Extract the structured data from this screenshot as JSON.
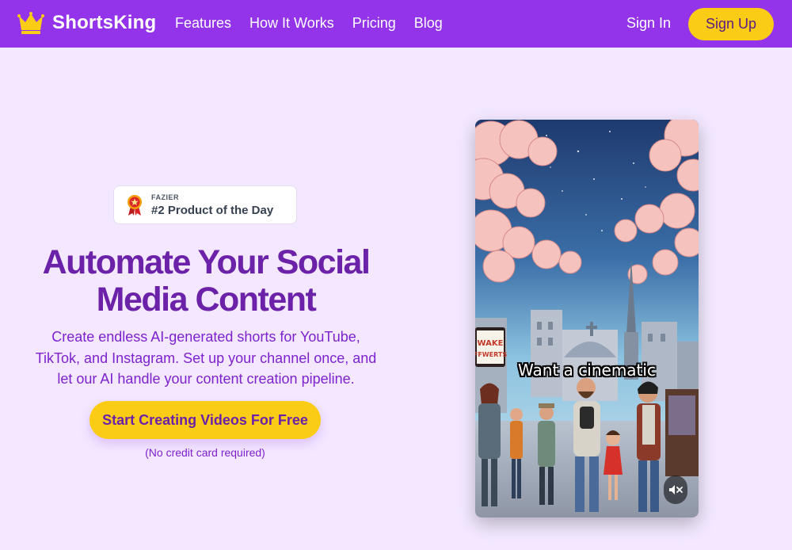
{
  "nav": {
    "brand": "ShortsKing",
    "links": [
      "Features",
      "How It Works",
      "Pricing",
      "Blog"
    ],
    "sign_in": "Sign In",
    "sign_up": "Sign Up"
  },
  "badge": {
    "kicker": "FAZIER",
    "title": "#2 Product of the Day"
  },
  "hero": {
    "title_line1": "Automate Your Social",
    "title_line2": "Media Content",
    "subtitle_line1": "Create endless AI-generated shorts for YouTube,",
    "subtitle_line2": "TikTok, and Instagram. Set up your channel once, and",
    "subtitle_line3": "let our AI handle your content creation pipeline.",
    "cta": "Start Creating Videos For Free",
    "note": "(No credit card required)"
  },
  "video": {
    "caption": "Want a cinematic",
    "sign_text_1": "WAKE",
    "sign_text_2": "FFWERTS",
    "mute_icon": "volume-muted-icon"
  },
  "colors": {
    "nav_bg": "#9333ea",
    "page_bg": "#f3e8ff",
    "accent_yellow": "#facc15",
    "heading_purple": "#6b21a8"
  }
}
